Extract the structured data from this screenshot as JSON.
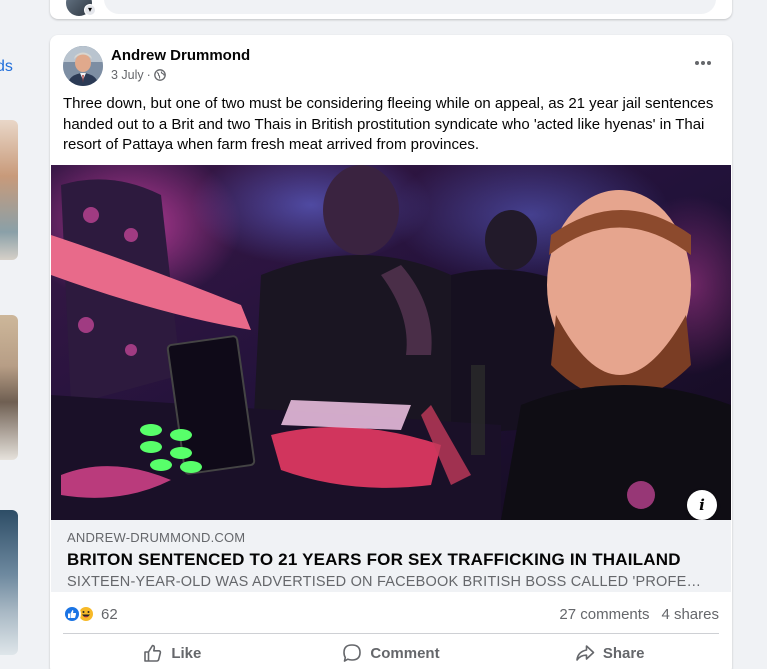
{
  "left_column": {
    "link_fragment": "ds"
  },
  "post": {
    "author": "Andrew Drummond",
    "date": "3 July",
    "separator": "·",
    "privacy_icon": "globe-icon",
    "more_icon": "more-options-icon",
    "text": "Three down, but one of two must be considering fleeing while on appeal, as 21 year jail sentences handed out to a Brit and two Thais  in British prostitution syndicate who 'acted like hyenas' in Thai resort of Pattaya when farm fresh meat arrived from provinces.",
    "image_info_icon": "i",
    "link": {
      "domain": "ANDREW-DRUMMOND.COM",
      "title": "BRITON SENTENCED TO 21 YEARS FOR SEX TRAFFICKING IN THAILAND",
      "description": "SIXTEEN-YEAR-OLD WAS ADVERTISED ON FACEBOOK BRITISH BOSS CALLED 'PROFESSOR MORIARTY' BY TEAM"
    },
    "stats": {
      "reaction_count": "62",
      "comments": "27 comments",
      "shares": "4 shares"
    },
    "actions": {
      "like": "Like",
      "comment": "Comment",
      "share": "Share"
    }
  },
  "colors": {
    "link_blue": "#216fdb",
    "like_blue": "#1b74e4",
    "haha_yellow": "#f7b928",
    "secondary_text": "#65676b"
  }
}
